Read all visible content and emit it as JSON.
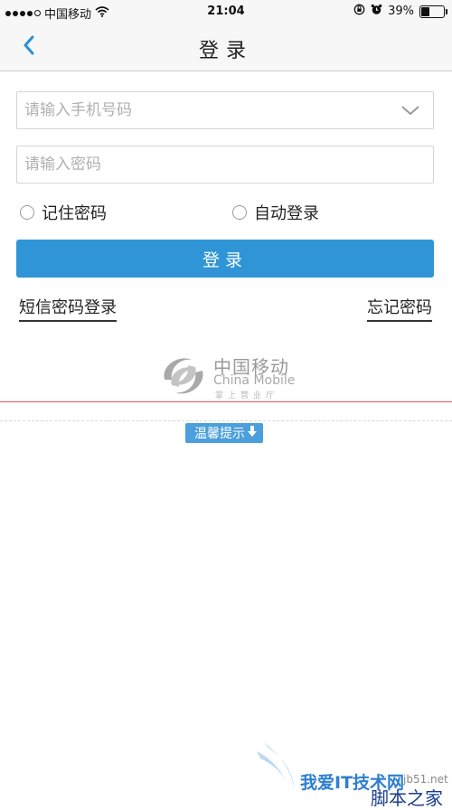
{
  "status_bar": {
    "carrier": "中国移动",
    "time": "21:04",
    "battery": "39%",
    "battery_level": 0.39
  },
  "nav": {
    "title": "登录",
    "back_icon": "chevron-left-icon"
  },
  "form": {
    "phone_placeholder": "请输入手机号码",
    "password_placeholder": "请输入密码",
    "remember_label": "记住密码",
    "auto_login_label": "自动登录",
    "login_label": "登录"
  },
  "links": {
    "sms_login": "短信密码登录",
    "forgot_password": "忘记密码"
  },
  "logo": {
    "cn": "中国移动",
    "en": "China Mobile",
    "sub": "掌上营业厅"
  },
  "tips": {
    "label": "温馨提示"
  },
  "watermark": {
    "line1": "我爱IT技术网",
    "line2": "jb51.net",
    "line3": "脚本之家"
  },
  "colors": {
    "primary": "#2f95d6",
    "tips": "#4a9fdc",
    "divider": "#e05a5a",
    "back": "#2a8fd8"
  }
}
